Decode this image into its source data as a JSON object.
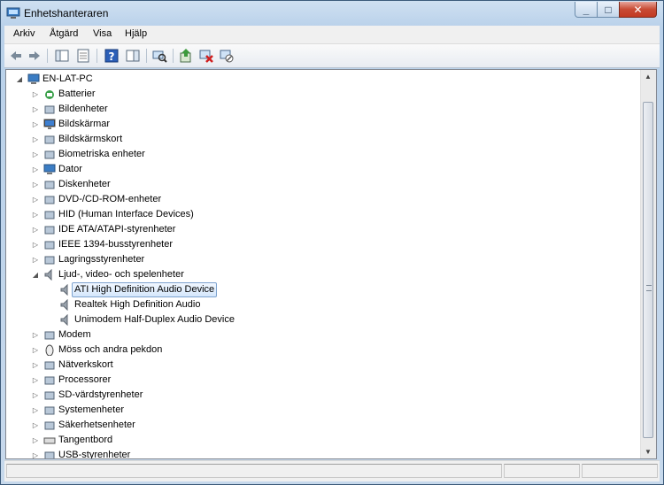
{
  "window": {
    "title": "Enhetshanteraren",
    "controls": {
      "minimize": "_",
      "maximize": "□",
      "close": "✕"
    }
  },
  "menu": [
    "Arkiv",
    "Åtgärd",
    "Visa",
    "Hjälp"
  ],
  "toolbar": {
    "icons": [
      "back-arrow-icon",
      "forward-arrow-icon",
      "show-hide-tree-icon",
      "properties-icon",
      "help-icon",
      "action-pane-icon",
      "scan-hardware-icon",
      "update-driver-icon",
      "uninstall-device-icon",
      "disable-device-icon"
    ]
  },
  "tree": {
    "root": {
      "label": "EN-LAT-PC",
      "expander": "◢"
    },
    "collapsed_glyph": "▷",
    "expanded_glyph": "◢",
    "categories": [
      {
        "label": "Batterier",
        "icon": "battery-icon"
      },
      {
        "label": "Bildenheter",
        "icon": "imaging-device-icon"
      },
      {
        "label": "Bildskärmar",
        "icon": "monitor-icon"
      },
      {
        "label": "Bildskärmskort",
        "icon": "display-adapter-icon"
      },
      {
        "label": "Biometriska enheter",
        "icon": "fingerprint-icon"
      },
      {
        "label": "Dator",
        "icon": "computer-icon"
      },
      {
        "label": "Diskenheter",
        "icon": "disk-drive-icon"
      },
      {
        "label": "DVD-/CD-ROM-enheter",
        "icon": "optical-drive-icon"
      },
      {
        "label": "HID (Human Interface Devices)",
        "icon": "hid-icon"
      },
      {
        "label": "IDE ATA/ATAPI-styrenheter",
        "icon": "ide-controller-icon"
      },
      {
        "label": "IEEE 1394-busstyrenheter",
        "icon": "firewire-icon"
      },
      {
        "label": "Lagringsstyrenheter",
        "icon": "storage-controller-icon"
      },
      {
        "label": "Ljud-, video- och spelenheter",
        "icon": "speaker-icon",
        "expanded": true,
        "children": [
          {
            "label": "ATI High Definition Audio Device",
            "icon": "speaker-icon",
            "selected": true
          },
          {
            "label": "Realtek High Definition Audio",
            "icon": "speaker-icon"
          },
          {
            "label": "Unimodem Half-Duplex Audio Device",
            "icon": "speaker-icon"
          }
        ]
      },
      {
        "label": "Modem",
        "icon": "modem-icon"
      },
      {
        "label": "Möss och andra pekdon",
        "icon": "mouse-icon"
      },
      {
        "label": "Nätverkskort",
        "icon": "network-adapter-icon"
      },
      {
        "label": "Processorer",
        "icon": "processor-icon"
      },
      {
        "label": "SD-värdstyrenheter",
        "icon": "sd-host-icon"
      },
      {
        "label": "Systemenheter",
        "icon": "system-devices-icon"
      },
      {
        "label": "Säkerhetsenheter",
        "icon": "security-device-icon"
      },
      {
        "label": "Tangentbord",
        "icon": "keyboard-icon"
      },
      {
        "label": "USB-styrenheter",
        "icon": "usb-icon"
      }
    ]
  },
  "scrollbar": {
    "up": "▲",
    "down": "▼"
  }
}
